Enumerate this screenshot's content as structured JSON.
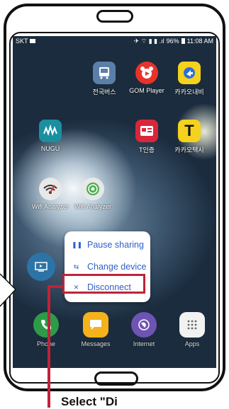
{
  "status_bar": {
    "carrier": "SKT",
    "battery": "96%",
    "time": "11:08 AM"
  },
  "apps": {
    "row1": [
      "전국버스",
      "GOM Player",
      "카카오내비"
    ],
    "row2": [
      "NUGU",
      "T인증",
      "카카오택시"
    ],
    "row3": [
      "Wifi Analyzer",
      "Wifi Analyzer"
    ]
  },
  "dock": [
    "Phone",
    "Messages",
    "Internet",
    "Apps"
  ],
  "share_menu": {
    "pause": "Pause sharing",
    "change": "Change device",
    "disconnect": "Disconnect"
  },
  "callout": {
    "text": "Select \"Di"
  },
  "colors": {
    "accent": "#2f5fc9",
    "highlight": "#c0223a"
  }
}
